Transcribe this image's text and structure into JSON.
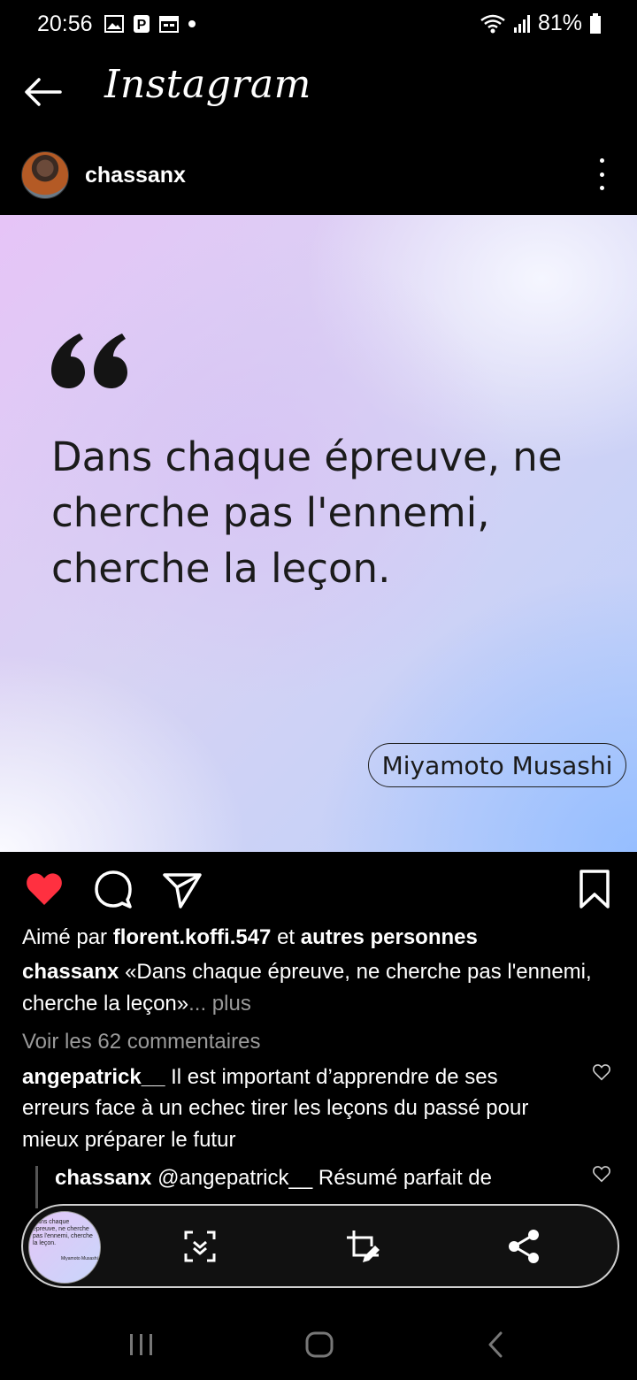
{
  "status_bar": {
    "time": "20:56",
    "battery": "81%"
  },
  "header": {
    "brand": "Instagram"
  },
  "post": {
    "username": "chassanx",
    "quote": "Dans chaque épreuve, ne cherche pas l'ennemi, cherche la leçon.",
    "quote_author": "Miyamoto Musashi"
  },
  "likes": {
    "prefix": "Aimé par ",
    "user": "florent.koffi.547",
    "middle": " et ",
    "others": "autres personnes"
  },
  "caption": {
    "user": "chassanx",
    "line1": " «Dans chaque épreuve, ne cherche pas l'ennemi,",
    "line2": "cherche la leçon»",
    "more": "... plus"
  },
  "view_comments": "Voir les 62 commentaires",
  "comments": [
    {
      "user": "angepatrick__",
      "line1": " Il est important d’apprendre de ses",
      "line2": "erreurs face à un echec tirer les leçons du passé pour",
      "line3": "mieux préparer le futur"
    },
    {
      "user": "chassanx",
      "line1": " @angepatrick__ Résumé parfait de"
    }
  ],
  "thumbnail": {
    "text": "Dans chaque épreuve, ne cherche pas l'ennemi, cherche la leçon.",
    "author": "Miyamoto Musashi"
  },
  "icons": {
    "back": "arrow-left-icon",
    "more": "more-vertical-icon",
    "like": "heart-filled-icon",
    "comment": "comment-icon",
    "share": "send-icon",
    "save": "bookmark-icon",
    "scroll_capture": "scroll-capture-icon",
    "crop": "crop-edit-icon",
    "share_sheet": "share-icon"
  },
  "colors": {
    "like": "#ff3040",
    "background": "#000000"
  }
}
